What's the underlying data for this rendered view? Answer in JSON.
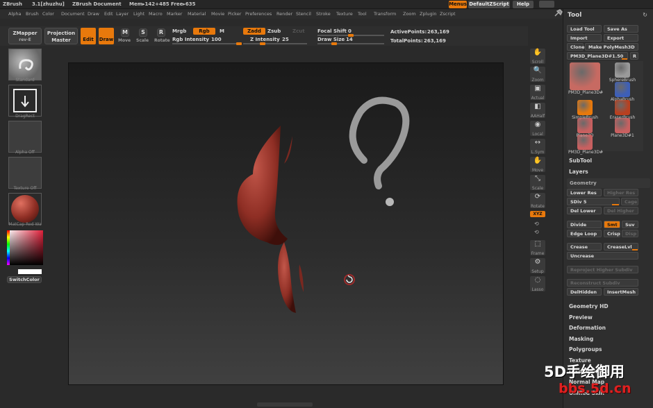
{
  "title_bar": {
    "app": "ZBrush",
    "version": "3.1[zhuzhu]",
    "document": "ZBrush Document",
    "mem": "Mem▸142+485 Free▸635",
    "menus_label": "Menus",
    "script_label": "DefaultZScript",
    "help_label": "Help"
  },
  "menu": [
    "Alpha",
    "Brush",
    "Color",
    "Document",
    "Draw",
    "Edit",
    "Layer",
    "Light",
    "Macro",
    "Marker",
    "Material",
    "Movie",
    "Picker",
    "Preferences",
    "Render",
    "Stencil",
    "Stroke",
    "Texture",
    "Tool",
    "Transform",
    "Zoom",
    "Zplugin",
    "Zscript"
  ],
  "toolbar": {
    "zmapper": "ZMapper",
    "zmapper_sub": "rev-E",
    "projection": "Projection",
    "projection_sub": "Master",
    "edit": "Edit",
    "draw": "Draw",
    "move": "Move",
    "scale": "Scale",
    "rotate": "Rotate",
    "mrgb": "Mrgb",
    "rgb": "Rgb",
    "m": "M",
    "rgb_intensity_label": "Rgb Intensity",
    "rgb_intensity": "100",
    "zadd": "Zadd",
    "zsub": "Zsub",
    "zcut": "Zcut",
    "z_intensity_label": "Z Intensity",
    "z_intensity": "25",
    "focal_shift_label": "Focal Shift",
    "focal_shift": "0",
    "draw_size_label": "Draw Size",
    "draw_size": "14",
    "active_points_label": "ActivePoints:",
    "active_points": "263,169",
    "total_points_label": "TotalPoints:",
    "total_points": "263,169"
  },
  "left_shelf": {
    "brush": "Standard",
    "stroke": "DragRect",
    "alpha": "Alpha  Off",
    "texture": "Texture  Off",
    "material": "MatCap  Red  Wa",
    "switch_color": "SwitchColor"
  },
  "right_shelf": [
    "Scroll",
    "Zoom",
    "Actual",
    "AAHalf",
    "Local",
    "L.Sym",
    "Move",
    "Scale",
    "Rotate",
    "XYZ",
    "Frame",
    "Setup",
    "Lasso"
  ],
  "tool_panel": {
    "title": "Tool",
    "load_tool": "Load Tool",
    "save_as": "Save As",
    "import": "Import",
    "export": "Export",
    "clone": "Clone",
    "make_polymesh": "Make PolyMesh3D",
    "current_tool": "PM3D_Plane3D#1",
    "current_value": "50",
    "r_button": "R",
    "tools": [
      {
        "name": "PM3D_Plane3D#",
        "color": "#c76a62"
      },
      {
        "name": "SphereBrush",
        "color": "#9a9a9a"
      },
      {
        "name": "AlphaBrush",
        "color": "#3d5fb8"
      },
      {
        "name": "SimpleBrush",
        "color": "#e8790c"
      },
      {
        "name": "EraserBrush",
        "color": "#b84020"
      },
      {
        "name": "Plane3D",
        "color": "#c86060"
      },
      {
        "name": "Plane3D#1",
        "color": "#c86060"
      },
      {
        "name": "PM3D_Plane3D#",
        "color": "#c86060"
      }
    ],
    "subtool": "SubTool",
    "layers": "Layers",
    "geometry": "Geometry",
    "lower_res": "Lower Res",
    "higher_res": "Higher Res",
    "sdiv_label": "SDiv",
    "sdiv": "5",
    "cage": "Cage",
    "del_lower": "Del Lower",
    "del_higher": "Del Higher",
    "divide": "Divide",
    "smt": "Smt",
    "suv": "Suv",
    "edge_loop": "Edge Loop",
    "crisp": "Crisp",
    "disp": "Disp",
    "crease": "Crease",
    "crease_lvl_label": "CreaseLvl",
    "crease_lvl": "15",
    "uncrease": "Uncrease",
    "reproject": "Reproject  Higher  Subdiv",
    "reconstruct": "Reconstruct  Subdiv",
    "delhidden": "DelHidden",
    "insertmesh": "InsertMesh",
    "sections": [
      "Geometry HD",
      "Preview",
      "Deformation",
      "Masking",
      "Polygroups",
      "Texture",
      "Displacement",
      "Normal Map",
      "Unified Skin"
    ]
  },
  "watermark": {
    "line1": "5D手绘御用",
    "line2": "bbs.5d.cn"
  },
  "colors": {
    "accent": "#e8790c",
    "model": "#8e2e24"
  }
}
